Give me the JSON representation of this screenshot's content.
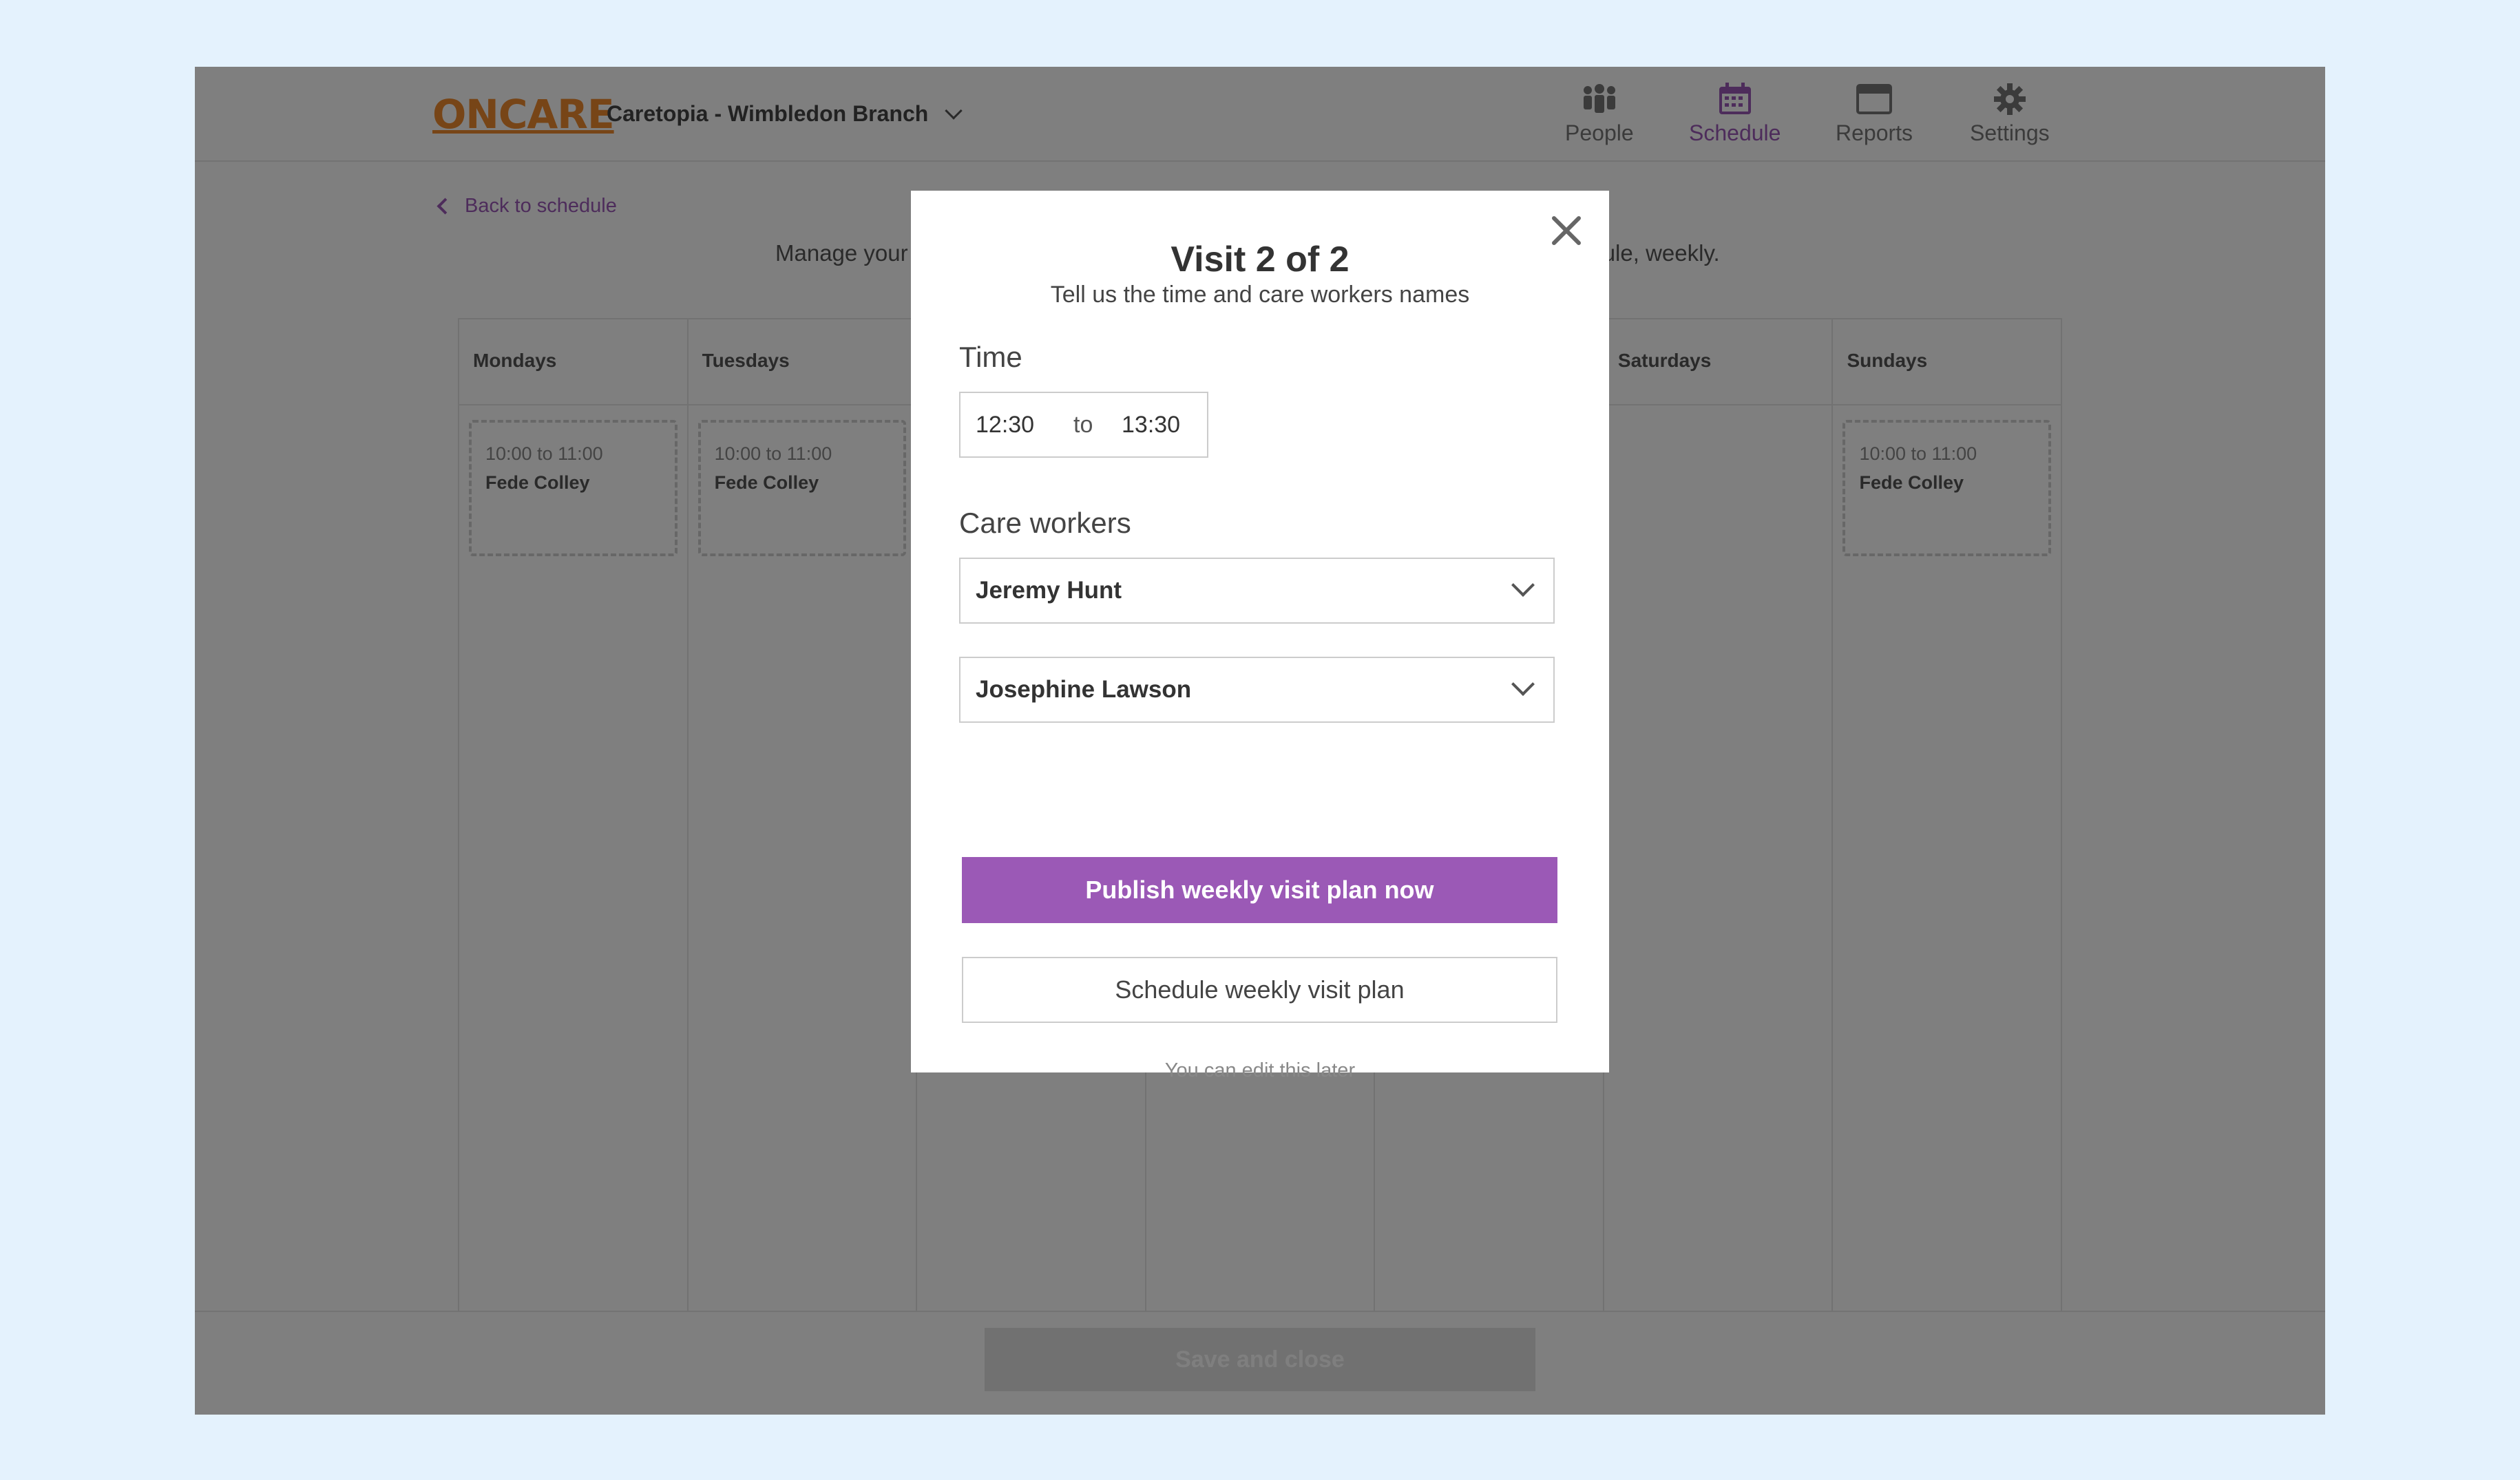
{
  "header": {
    "logo": "ONCARE",
    "branch": "Caretopia - Wimbledon Branch",
    "nav": [
      {
        "label": "People",
        "icon": "people-icon"
      },
      {
        "label": "Schedule",
        "icon": "calendar-icon"
      },
      {
        "label": "Reports",
        "icon": "reports-icon"
      },
      {
        "label": "Settings",
        "icon": "gear-icon"
      }
    ]
  },
  "back_link": "Back to schedule",
  "intro": {
    "left": "Manage your",
    "right": "edule, weekly."
  },
  "days": [
    {
      "label": "Mondays",
      "slot_time": "10:00 to 11:00",
      "slot_worker": "Fede Colley"
    },
    {
      "label": "Tuesdays",
      "slot_time": "10:00 to 11:00",
      "slot_worker": "Fede Colley"
    },
    {
      "label": ""
    },
    {
      "label": ""
    },
    {
      "label": ""
    },
    {
      "label": "Saturdays"
    },
    {
      "label": "Sundays",
      "slot_time": "10:00 to 11:00",
      "slot_worker": "Fede Colley"
    }
  ],
  "footer": {
    "save_label": "Save and close"
  },
  "modal": {
    "title": "Visit 2 of 2",
    "subtitle": "Tell us the time and care workers names",
    "time_label": "Time",
    "time_from": "12:30",
    "time_sep": "to",
    "time_to": "13:30",
    "workers_label": "Care workers",
    "worker_1": "Jeremy Hunt",
    "worker_2": "Josephine Lawson",
    "publish_label": "Publish weekly visit plan now",
    "schedule_label": "Schedule weekly visit plan",
    "note": "You can edit this later"
  },
  "colors": {
    "brand": "#ef8a2e",
    "accent": "#9b59b6",
    "page_bg": "#e4f2fd"
  }
}
